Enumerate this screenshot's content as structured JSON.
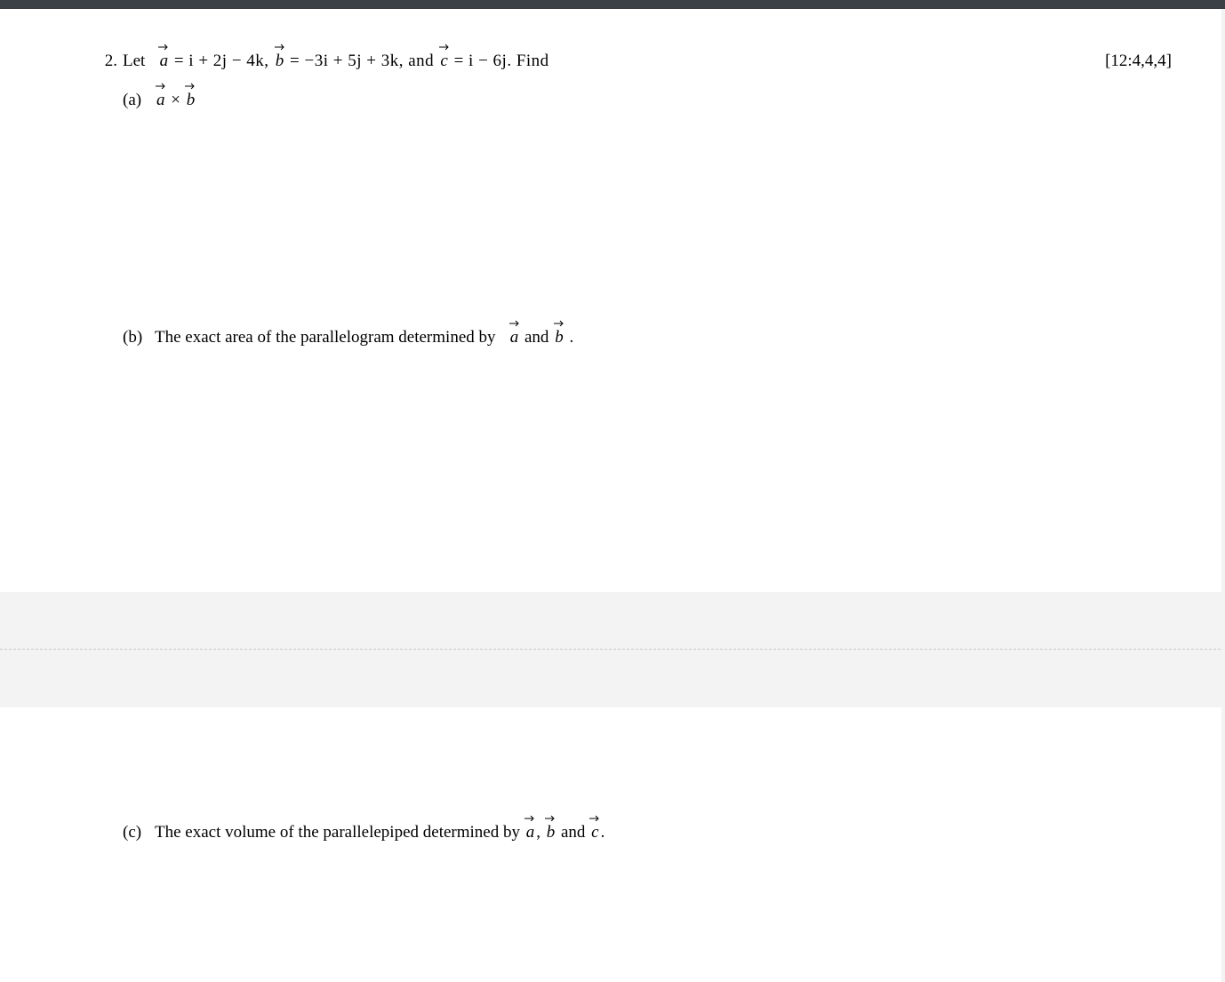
{
  "question": {
    "number": "2.",
    "stem_prefix": "Let ",
    "vec_a_def": " = i + 2j − 4k,   ",
    "vec_b_def": " = −3i + 5j + 3k,  and ",
    "vec_c_def": " = i − 6j. Find",
    "marks": "[12:4,4,4]",
    "parts": {
      "a": {
        "label": "(a)",
        "text_cross": " × "
      },
      "b": {
        "label": "(b)",
        "text_before": "The exact area of the parallelogram determined by ",
        "text_mid": " and ",
        "text_after": "."
      },
      "c": {
        "label": "(c)",
        "text_before": "The exact volume of the parallelepiped determined by ",
        "sep1": ", ",
        "sep2": " and ",
        "text_after": "."
      }
    }
  },
  "vectors": {
    "a": "a",
    "b": "b",
    "c": "c"
  }
}
